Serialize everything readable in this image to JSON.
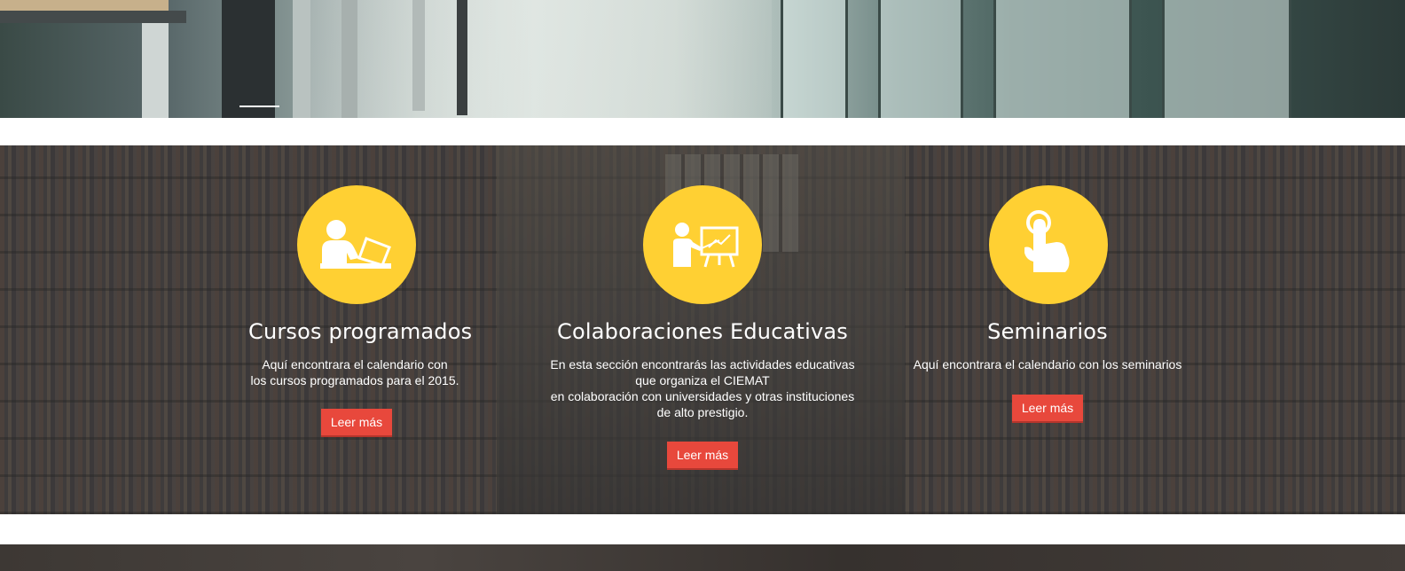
{
  "features": [
    {
      "icon": "person-laptop-icon",
      "title": "Cursos programados",
      "description": [
        "Aquí encontrara el calendario con",
        "los cursos programados para el 2015."
      ],
      "button": "Leer más"
    },
    {
      "icon": "teacher-presentation-icon",
      "title": "Colaboraciones Educativas",
      "description": [
        "En esta sección encontrarás las actividades educativas",
        "que organiza el CIEMAT",
        "en colaboración con universidades y otras instituciones",
        "de alto prestigio."
      ],
      "button": "Leer más"
    },
    {
      "icon": "hand-pointer-icon",
      "title": "Seminarios",
      "description": [
        "Aquí encontrara el calendario con los seminarios"
      ],
      "button": "Leer más"
    }
  ],
  "colors": {
    "accent_yellow": "#ffd033",
    "button_red": "#e8483c"
  }
}
